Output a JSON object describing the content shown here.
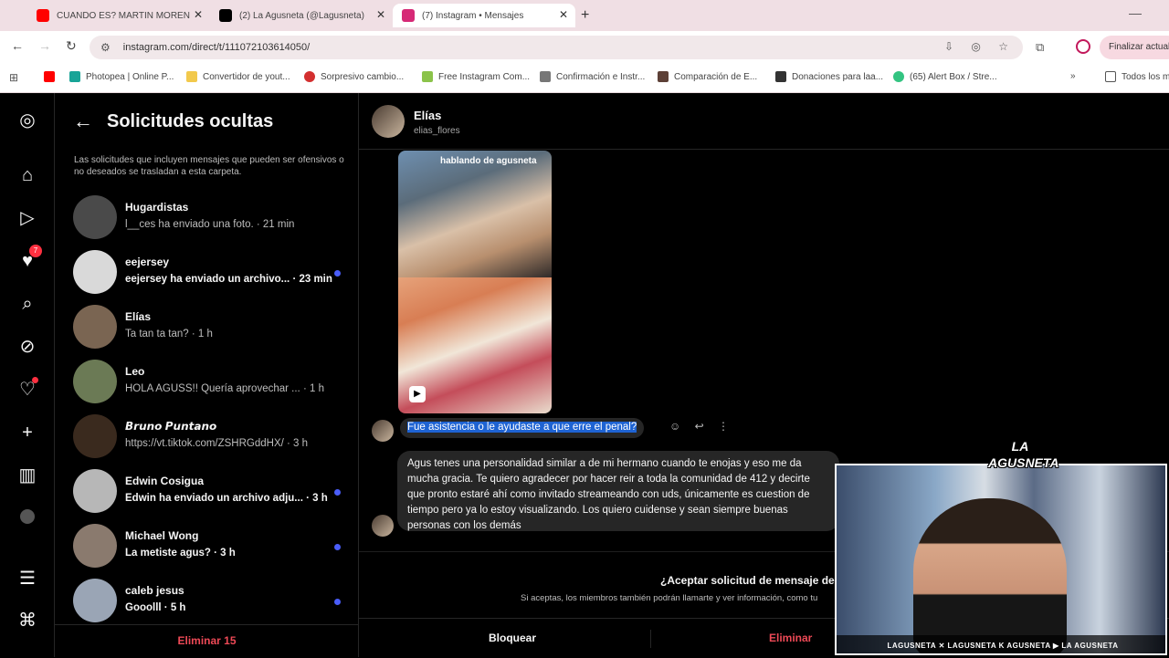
{
  "browser": {
    "tabs": [
      {
        "title": "CUANDO ES? MARTIN MOREN",
        "favicon_color": "#ff0000"
      },
      {
        "title": "(2) La Agusneta (@Lagusneta)",
        "favicon_color": "#000000"
      },
      {
        "title": "(7) Instagram • Mensajes",
        "favicon_color": "#d62976"
      }
    ],
    "address": "instagram.com/direct/t/111072103614050/",
    "profile_action": "Finalizar actual",
    "bookmarks": [
      {
        "label": "",
        "color": "#ff0000"
      },
      {
        "label": "Photopea | Online P...",
        "color": "#18a497"
      },
      {
        "label": "Convertidor de yout...",
        "color": "#f2c94c"
      },
      {
        "label": "Sorpresivo cambio...",
        "color": "#d32f2f"
      },
      {
        "label": "Free Instagram Com...",
        "color": "#8bc34a"
      },
      {
        "label": "Confirmación e Instr...",
        "color": "#777777"
      },
      {
        "label": "Comparación de E...",
        "color": "#5d4037"
      },
      {
        "label": "Donaciones para laa...",
        "color": "#333333"
      },
      {
        "label": "(65) Alert Box / Stre...",
        "color": "#33c481"
      }
    ],
    "bookmarks_folder": "Todos los m"
  },
  "rail": {
    "notif_count": "7"
  },
  "requests_panel": {
    "title": "Solicitudes ocultas",
    "description": "Las solicitudes que incluyen mensajes que pueden ser ofensivos o no deseados se trasladan a esta carpeta.",
    "items": [
      {
        "name": "Hugardistas",
        "preview": "l__ces ha enviado una foto. · 21 min",
        "unread": false,
        "avatar": "#4a4a4a"
      },
      {
        "name": "eejersey",
        "preview": "eejersey ha enviado un archivo... · 23 min",
        "unread": true,
        "avatar": "#d9d9d9"
      },
      {
        "name": "Elías",
        "preview": "Ta tan ta tan? · 1 h",
        "unread": false,
        "avatar": "#7a6552"
      },
      {
        "name": "Leo",
        "preview": "HOLA AGUSS!! Quería aprovechar ... · 1 h",
        "unread": false,
        "avatar": "#6b7a55"
      },
      {
        "name": "𝘽𝙧𝙪𝙣𝙤 𝙋𝙪𝙣𝙩𝙖𝙣𝙤",
        "preview": "https://vt.tiktok.com/ZSHRGddHX/ · 3 h",
        "unread": false,
        "avatar": "#3a2a1e"
      },
      {
        "name": "Edwin Cosigua",
        "preview": "Edwin ha enviado un archivo adju... · 3 h",
        "unread": true,
        "avatar": "#b7b7b7"
      },
      {
        "name": "Michael Wong",
        "preview": "La metiste agus? · 3 h",
        "unread": true,
        "avatar": "#8a7a6e"
      },
      {
        "name": "caleb jesus",
        "preview": "Gooolll · 5 h",
        "unread": true,
        "avatar": "#9aa5b5"
      }
    ],
    "delete_label": "Eliminar 15"
  },
  "chat": {
    "name": "Elías",
    "username": "elias_flores",
    "video_watermark": "hablando de agusneta",
    "message1": "Fue asistencia o le ayudaste a que erre el penal?",
    "message2": "Agus tenes una personalidad similar a de mi hermano cuando te enojas y eso me da mucha gracia. Te quiero agradecer por hacer reir a toda la comunidad de 412 y decirte que pronto estaré ahí como invitado streameando con uds, únicamente es cuestion de tiempo pero ya lo estoy visualizando. Los quiero cuidense y sean siempre buenas personas con los demás",
    "accept_title": "¿Aceptar solicitud de mensaje de Elía",
    "accept_desc": "Si aceptas, los miembros también podrán llamarte y ver información, como tu",
    "block_label": "Bloquear",
    "delete_label": "Eliminar"
  },
  "webcam": {
    "logo": "LA AGUSNETA",
    "social_bar": "LAGUSNETA  ✕ LAGUSNETA  K AGUSNETA  ▶ LA AGUSNETA"
  }
}
